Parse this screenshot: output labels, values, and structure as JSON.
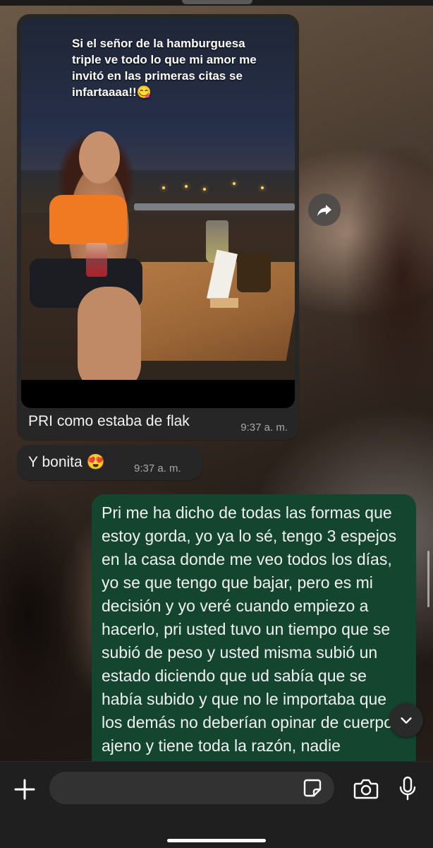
{
  "media_message": {
    "overlay_text": "Si el señor de la hamburguesa triple ve todo lo que mi amor me invitó en las primeras citas se infartaaaa!!😋",
    "caption": "PRI como estaba de flak",
    "time": "9:37 a. m."
  },
  "message_bonita": {
    "text": "Y bonita 😍",
    "time": "9:37 a. m."
  },
  "outgoing_message": {
    "text": "Pri me ha dicho de todas las formas que estoy gorda, yo ya lo sé, tengo 3 espejos en la casa donde me veo todos los días, yo se que tengo que bajar, pero es mi decisión y yo veré cuando empiezo a hacerlo, pri usted tuvo un tiempo que se subió de peso y usted misma subió un estado diciendo que ud sabía que se había subido y que no le importaba que los demás no deberían opinar de cuerpo ajeno y tiene toda la razón, nadie"
  },
  "icons": {
    "forward": "forward-arrow-icon",
    "scroll_down": "chevron-down-icon",
    "plus": "plus-icon",
    "sticker": "sticker-icon",
    "camera": "camera-icon",
    "mic": "microphone-icon"
  },
  "colors": {
    "incoming_bubble": "#262626",
    "outgoing_bubble": "#13452f",
    "input_bar": "#1f1f1f"
  }
}
